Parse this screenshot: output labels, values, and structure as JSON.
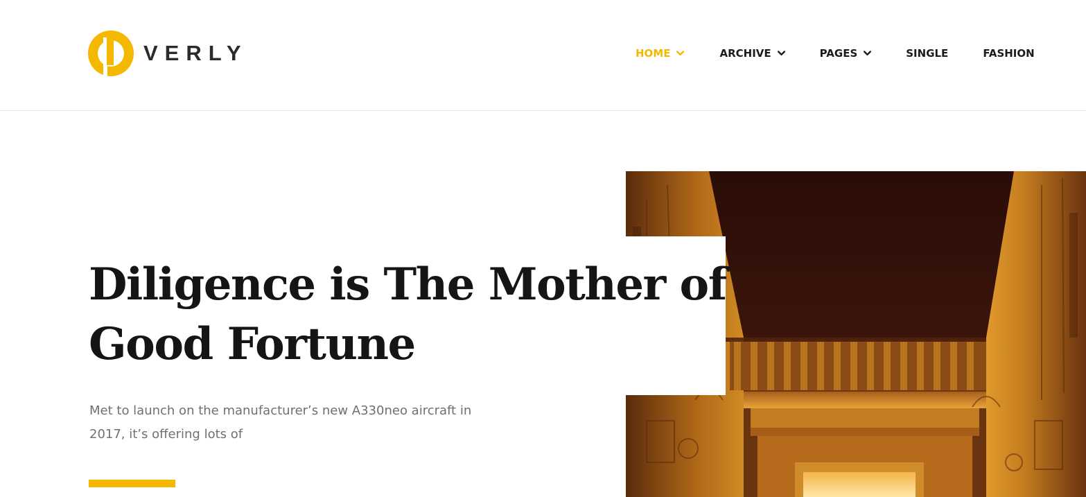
{
  "brand": {
    "name": "VERLY",
    "accent": "#f5b800",
    "text_color": "#2b2b2b"
  },
  "nav": {
    "items": [
      {
        "label": "HOME",
        "active": true,
        "has_dropdown": true
      },
      {
        "label": "ARCHIVE",
        "active": false,
        "has_dropdown": true
      },
      {
        "label": "PAGES",
        "active": false,
        "has_dropdown": true
      },
      {
        "label": "SINGLE",
        "active": false,
        "has_dropdown": false
      },
      {
        "label": "FASHION",
        "active": false,
        "has_dropdown": false
      }
    ],
    "dropdown_icon": "chevron-down-icon"
  },
  "hero": {
    "title_line1": "Diligence is The Mother of",
    "title_line2": "Good Fortune",
    "excerpt_line1": "Met to launch on the manufacturer’s new A330neo aircraft in",
    "excerpt_line2": "2017, it’s offering lots of",
    "image_subject": "egyptian-tomb-corridor",
    "accent_bar_color": "#f5b800"
  }
}
